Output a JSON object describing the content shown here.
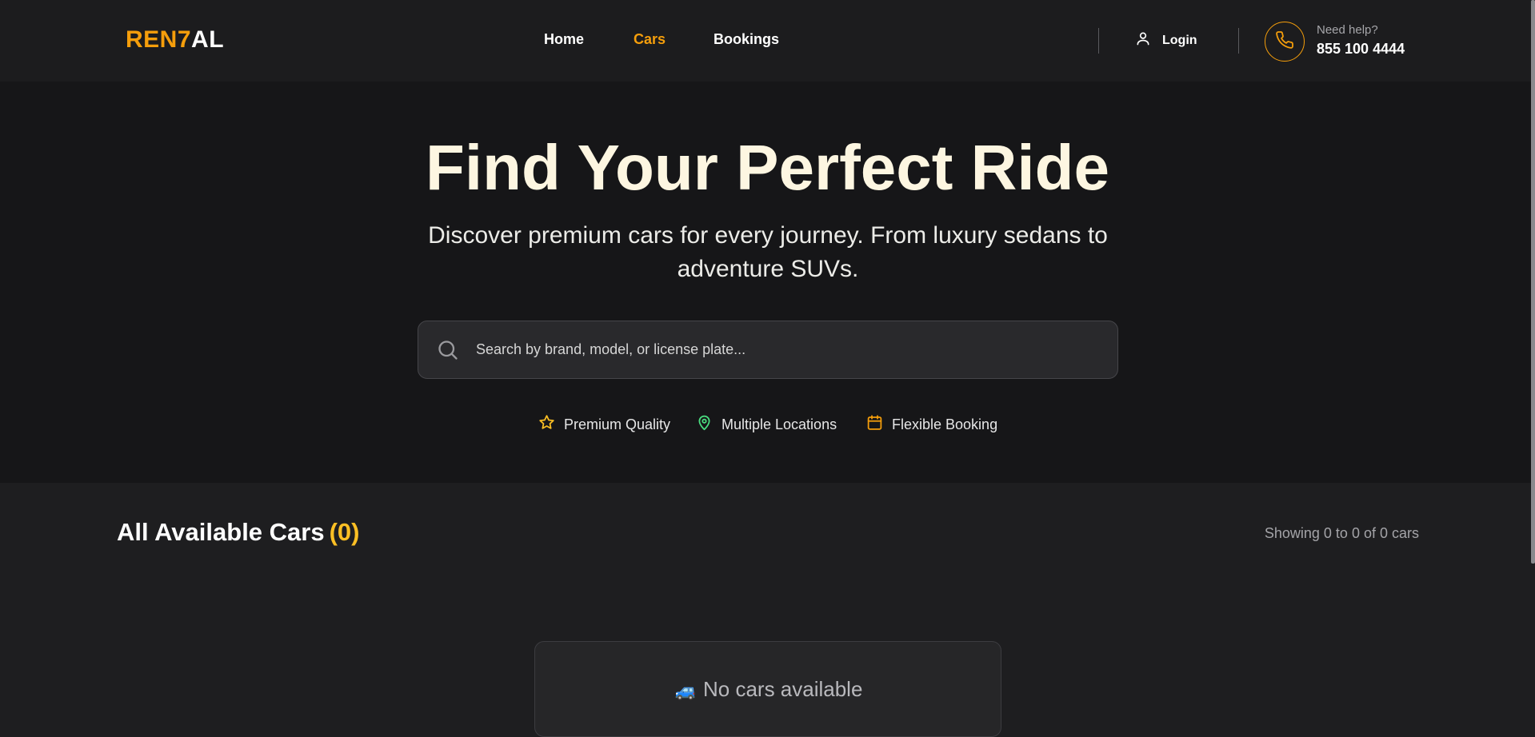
{
  "header": {
    "logo": {
      "accent": "REN7",
      "rest": "AL"
    },
    "nav": [
      {
        "label": "Home",
        "active": false
      },
      {
        "label": "Cars",
        "active": true
      },
      {
        "label": "Bookings",
        "active": false
      }
    ],
    "login_label": "Login",
    "help_label": "Need help?",
    "help_phone": "855 100 4444"
  },
  "hero": {
    "title": "Find Your Perfect Ride",
    "subtitle": "Discover premium cars for every journey. From luxury sedans to adventure SUVs.",
    "search_placeholder": "Search by brand, model, or license plate..."
  },
  "features": [
    {
      "icon": "star-icon",
      "label": "Premium Quality",
      "color": "#fbbf24"
    },
    {
      "icon": "map-pin-icon",
      "label": "Multiple Locations",
      "color": "#4ade80"
    },
    {
      "icon": "calendar-icon",
      "label": "Flexible Booking",
      "color": "#f59e0b"
    }
  ],
  "listing": {
    "title": "All Available Cars",
    "count": "(0)",
    "showing": "Showing 0 to 0 of 0 cars",
    "empty_icon": "🚙",
    "empty_text": "No cars available"
  },
  "colors": {
    "accent": "#f59e0b",
    "count": "#fbbf24",
    "hero_title": "#fdf6e1"
  }
}
